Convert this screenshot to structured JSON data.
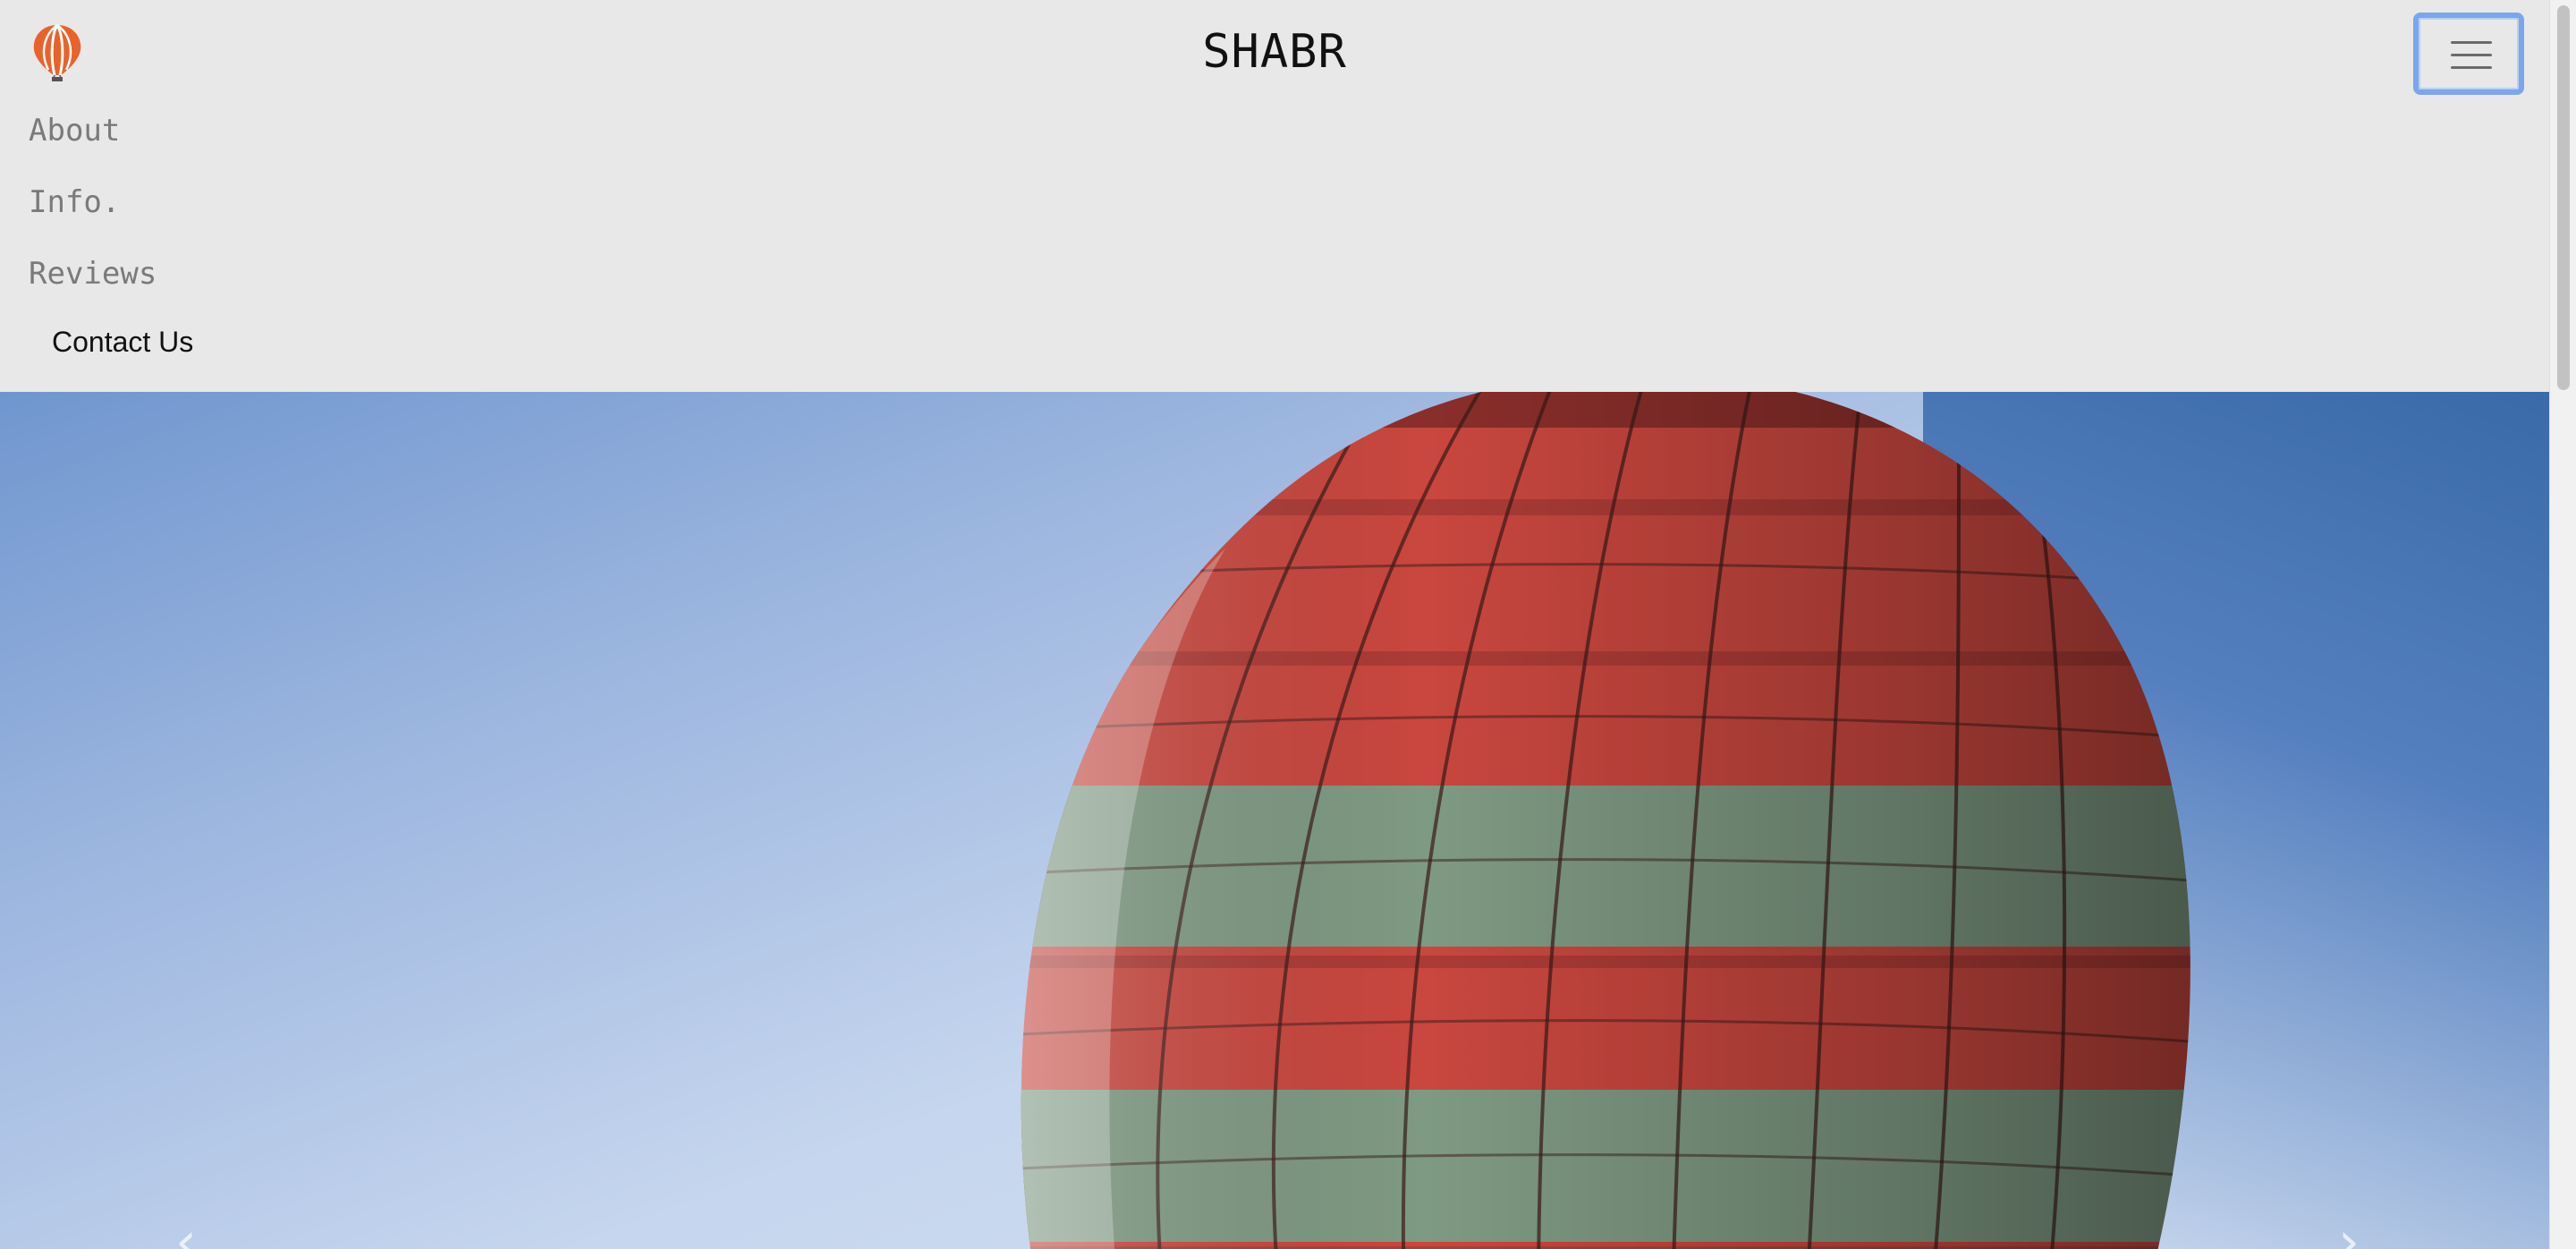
{
  "navbar": {
    "brand_title": "SHABR",
    "logo_icon": "hot-air-balloon-logo-icon",
    "toggle_icon": "hamburger-menu-icon",
    "links": [
      "About",
      "Info.",
      "Reviews"
    ],
    "contact_label": "Contact Us"
  },
  "hero": {
    "image": "hot air balloon against blue sky",
    "prev_icon": "chevron-left-icon",
    "next_icon": "chevron-right-icon"
  },
  "colors": {
    "navbar_bg": "#e8e8e8",
    "focus_ring": "#7ba6ec",
    "logo_accent": "#e8622c"
  }
}
